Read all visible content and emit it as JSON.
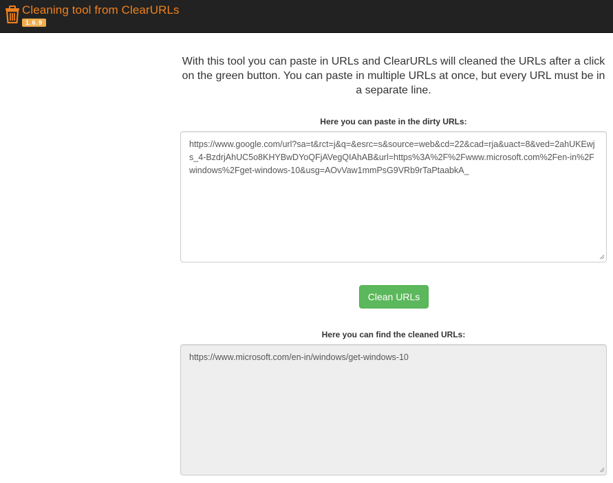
{
  "header": {
    "title": "Cleaning tool from ClearURLs",
    "version": "1.6.9",
    "icon": "trash-icon",
    "title_color": "#f0811e",
    "badge_color": "#f0ad4e",
    "bar_color": "#222222"
  },
  "main": {
    "intro": "With this tool you can paste in URLs and ClearURLs will cleaned the URLs after a click on the green button. You can paste in multiple URLs at once, but every URL must be in a separate line.",
    "dirty_label": "Here you can paste in the dirty URLs:",
    "dirty_value": "https://www.google.com/url?sa=t&rct=j&q=&esrc=s&source=web&cd=22&cad=rja&uact=8&ved=2ahUKEwjs_4-BzdrjAhUC5o8KHYBwDYoQFjAVegQIAhAB&url=https%3A%2F%2Fwww.microsoft.com%2Fen-in%2Fwindows%2Fget-windows-10&usg=AOvVaw1mmPsG9VRb9rTaPtaabkA_",
    "clean_button_label": "Clean URLs",
    "clean_button_color": "#5cb85c",
    "clean_label": "Here you can find the cleaned URLs:",
    "clean_value": "https://www.microsoft.com/en-in/windows/get-windows-10"
  }
}
